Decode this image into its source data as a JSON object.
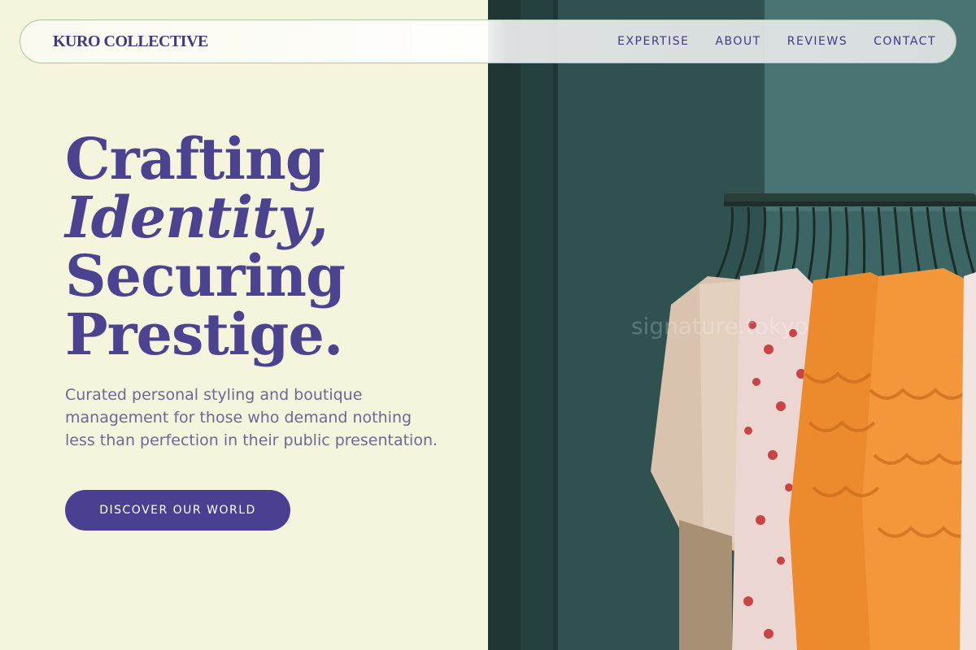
{
  "header": {
    "brand": "KURO COLLECTIVE",
    "nav": [
      {
        "label": "EXPERTISE"
      },
      {
        "label": "ABOUT"
      },
      {
        "label": "REVIEWS"
      },
      {
        "label": "CONTACT"
      }
    ]
  },
  "hero": {
    "title_line1": "Crafting",
    "title_line2_italic": "Identity",
    "title_line2_tail": ",",
    "title_line3": "Securing",
    "title_line4": "Prestige.",
    "description": "Curated personal styling and boutique management for those who demand nothing less than perfection in their public presentation.",
    "cta_label": "DISCOVER OUR WORLD"
  },
  "image": {
    "watermark": "signature.tokyo"
  },
  "colors": {
    "background": "#f5f4dc",
    "accent": "#4b3f91",
    "text_primary": "#4b4290",
    "text_secondary": "#6d6895"
  }
}
